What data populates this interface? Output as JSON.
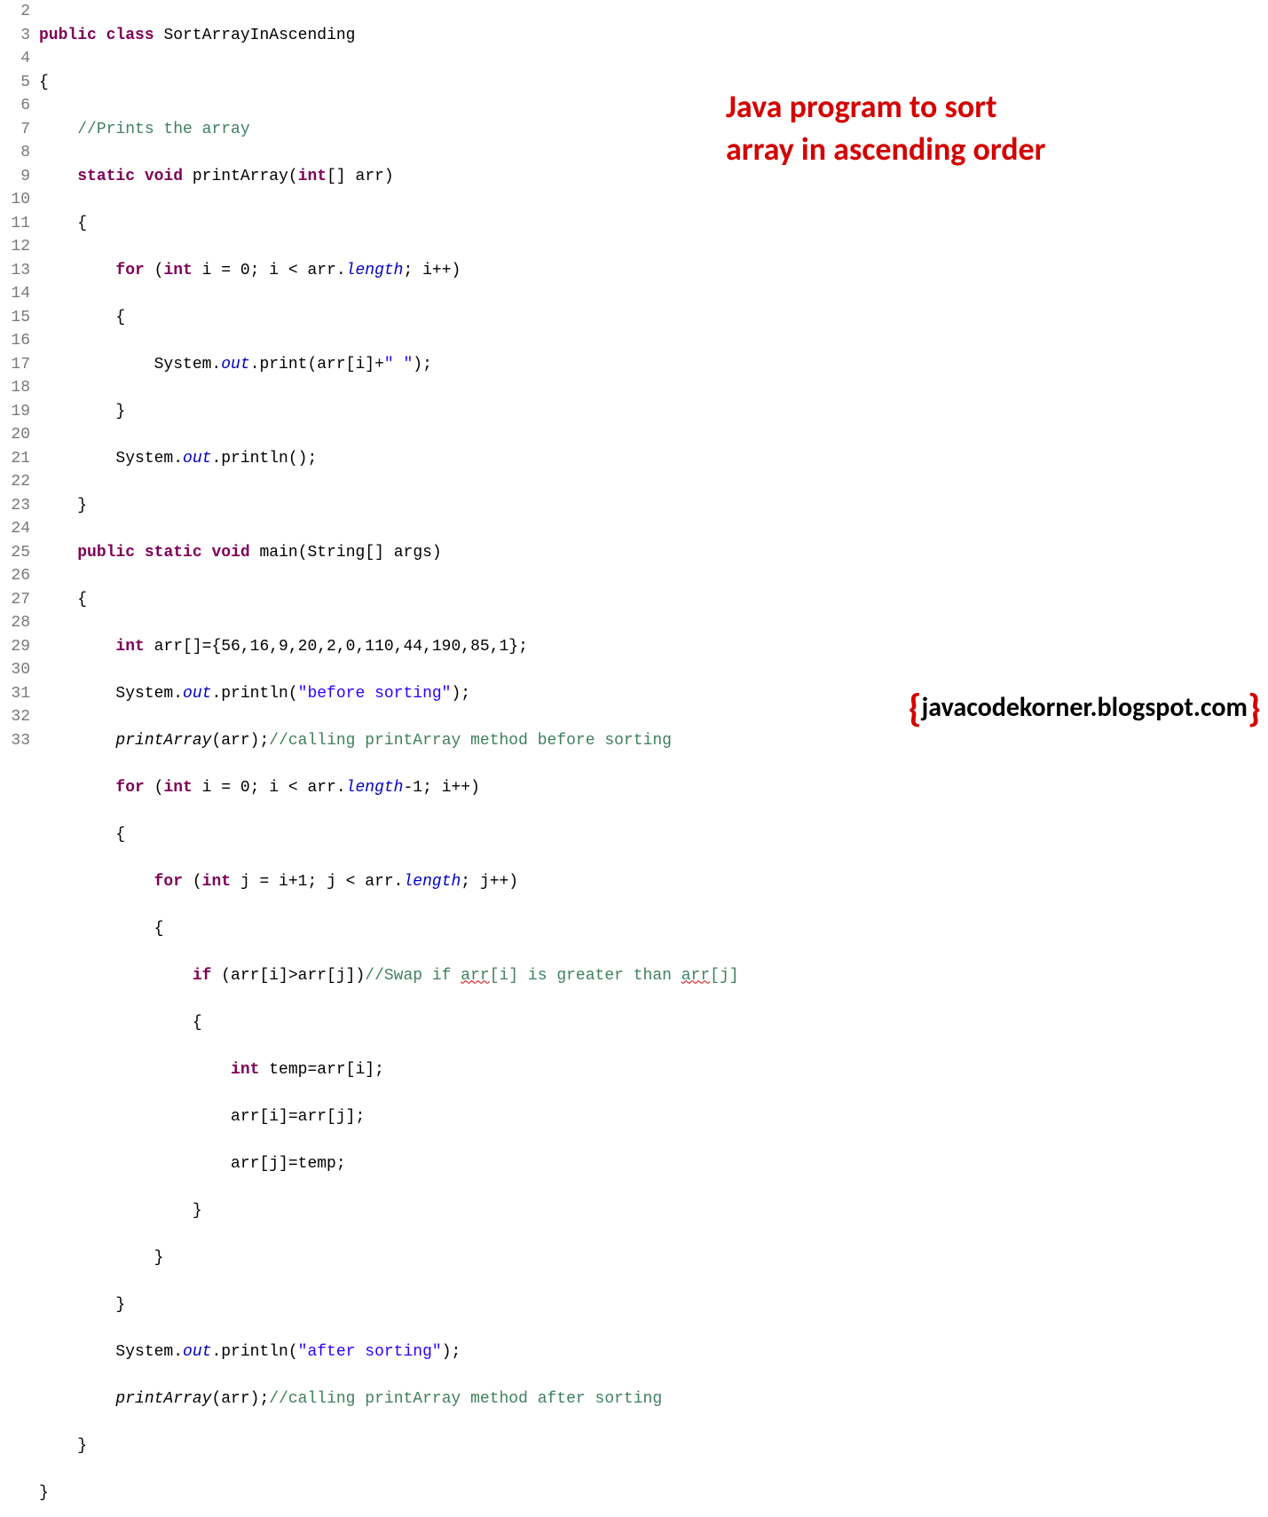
{
  "overlay": {
    "title_line1": "Java program to sort",
    "title_line2": "array in ascending order",
    "brand": "javacodekorner.blogspot.com"
  },
  "gutter": [
    "2",
    "3",
    "4",
    "5",
    "6",
    "7",
    "8",
    "9",
    "10",
    "11",
    "12",
    "13",
    "14",
    "15",
    "16",
    "17",
    "18",
    "19",
    "20",
    "21",
    "22",
    "23",
    "24",
    "25",
    "26",
    "27",
    "28",
    "29",
    "30",
    "31",
    "32",
    "33"
  ],
  "code": {
    "l2": {
      "kw1": "public",
      "kw2": "class",
      "name": "SortArrayInAscending"
    },
    "l3": {
      "t": "{"
    },
    "l4": {
      "c": "//Prints the array"
    },
    "l5": {
      "kw1": "static",
      "kw2": "void",
      "name": "printArray(",
      "kw3": "int",
      "rest": "[] arr)"
    },
    "l6": {
      "t": "    {"
    },
    "l7": {
      "kw1": "for",
      "p1": " (",
      "kw2": "int",
      "p2": " i = 0; i < arr.",
      "f": "length",
      "p3": "; i++)"
    },
    "l8": {
      "t": "        {"
    },
    "l9": {
      "p1": "            System.",
      "f": "out",
      "p2": ".print(arr[i]+",
      "s": "\" \"",
      "p3": ");"
    },
    "l10": {
      "t": "        }"
    },
    "l11": {
      "p1": "        System.",
      "f": "out",
      "p2": ".println();"
    },
    "l12": {
      "t": "    }"
    },
    "l13": {
      "kw1": "public",
      "kw2": "static",
      "kw3": "void",
      "name": "main(String[] args)"
    },
    "l14": {
      "t": "    {"
    },
    "l15": {
      "kw": "int",
      "rest": " arr[]={56,16,9,20,2,0,110,44,190,85,1};"
    },
    "l16": {
      "p1": "        System.",
      "f": "out",
      "p2": ".println(",
      "s": "\"before sorting\"",
      "p3": ");"
    },
    "l17": {
      "m": "printArray",
      "p": "(arr);",
      "c": "//calling printArray method before sorting"
    },
    "l18": {
      "kw1": "for",
      "p1": " (",
      "kw2": "int",
      "p2": " i = 0; i < arr.",
      "f": "length",
      "p3": "-1; i++)"
    },
    "l19": {
      "t": "        {"
    },
    "l20": {
      "kw1": "for",
      "p1": " (",
      "kw2": "int",
      "p2": " j = i+1; j < arr.",
      "f": "length",
      "p3": "; j++)"
    },
    "l21": {
      "t": "            {"
    },
    "l22": {
      "kw": "if",
      "p1": " (arr[i]>arr[j])",
      "c1": "//Swap if ",
      "w1": "arr",
      "c2": "[i] is greater than ",
      "w2": "arr",
      "c3": "[j]"
    },
    "l23": {
      "t": "                {"
    },
    "l24": {
      "kw": "int",
      "rest": " temp=arr[i];"
    },
    "l25": {
      "t": "                    arr[i]=arr[j];"
    },
    "l26": {
      "t": "                    arr[j]=temp;"
    },
    "l27": {
      "t": "                }"
    },
    "l28": {
      "t": "            }"
    },
    "l29": {
      "t": "        }"
    },
    "l30": {
      "p1": "        System.",
      "f": "out",
      "p2": ".println(",
      "s": "\"after sorting\"",
      "p3": ");"
    },
    "l31": {
      "m": "printArray",
      "p": "(arr);",
      "c": "//calling printArray method after sorting"
    },
    "l32": {
      "t": "    }"
    },
    "l33": {
      "t": "}"
    }
  }
}
